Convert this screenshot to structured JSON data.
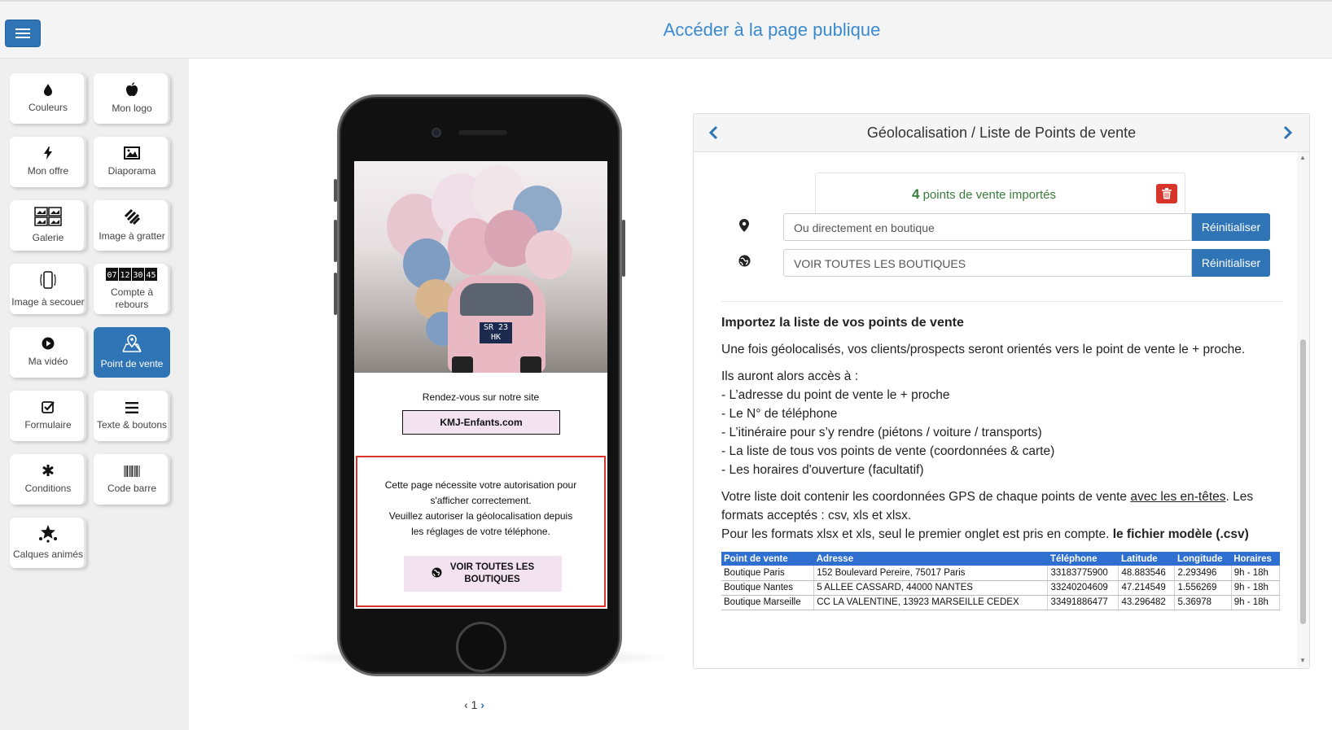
{
  "header": {
    "public_link": "Accéder à la page publique"
  },
  "sidebar": {
    "tools": [
      {
        "label": "Couleurs",
        "icon": "drop-icon",
        "glyph": "💧"
      },
      {
        "label": "Mon logo",
        "icon": "apple-icon",
        "glyph": ""
      },
      {
        "label": "Mon offre",
        "icon": "bolt-icon",
        "glyph": "⚡"
      },
      {
        "label": "Diaporama",
        "icon": "image-icon",
        "glyph": "🖼"
      },
      {
        "label": "Galerie",
        "icon": "gallery-icon",
        "glyph": "▦"
      },
      {
        "label": "Image à gratter",
        "icon": "scratch-icon",
        "glyph": "⫽"
      },
      {
        "label": "Image à secouer",
        "icon": "shake-phone-icon",
        "glyph": "📱"
      },
      {
        "label": "Compte à rebours",
        "icon": "countdown-icon",
        "glyph": "07 12 30 45"
      },
      {
        "label": "Ma vidéo",
        "icon": "play-icon",
        "glyph": "▶"
      },
      {
        "label": "Point de vente",
        "icon": "map-pin-icon",
        "glyph": "⌖"
      },
      {
        "label": "Formulaire",
        "icon": "checkbox-icon",
        "glyph": "☑"
      },
      {
        "label": "Texte & boutons",
        "icon": "list-icon",
        "glyph": "☰"
      },
      {
        "label": "Conditions",
        "icon": "asterisk-icon",
        "glyph": "✱"
      },
      {
        "label": "Code barre",
        "icon": "barcode-icon",
        "glyph": "||||"
      },
      {
        "label": "Calques animés",
        "icon": "stars-icon",
        "glyph": "★"
      }
    ],
    "active": "Point de vente"
  },
  "phone": {
    "plate": "SR 23 HK",
    "rdv_text": "Rendez-vous sur notre site",
    "site_button": "KMJ-Enfants.com",
    "alert_line1": "Cette page nécessite votre autorisation pour",
    "alert_line2": "s'afficher correctement.",
    "alert_line3": "Veuillez autoriser la géolocalisation depuis",
    "alert_line4": "les réglages de votre téléphone.",
    "stores_button_line1": "VOIR TOUTES LES",
    "stores_button_line2": "BOUTIQUES"
  },
  "pager": {
    "page": "1"
  },
  "panel": {
    "title": "Géolocalisation / Liste de Points de vente",
    "count": "4",
    "count_label": "points de vente importés",
    "field1_value": "Ou directement en boutique",
    "field2_value": "VOIR TOUTES LES BOUTIQUES",
    "reset_label": "Réinitialiser",
    "info_title": "Importez la liste de vos points de vente",
    "info_p1": "Une fois géolocalisés, vos clients/prospects seront orientés vers le point de vente le + proche.",
    "info_p2_intro": "Ils auront alors accès à :",
    "info_bullets": [
      "- L’adresse du point de vente le + proche",
      "- Le N° de téléphone",
      "- L’itinéraire pour s’y rendre (piétons / voiture / transports)",
      "- La liste de tous vos points de vente (coordonnées & carte)",
      "- Les horaires d'ouverture (facultatif)"
    ],
    "info_p3_a": "Votre liste doit contenir les coordonnées GPS de chaque points de vente ",
    "info_p3_link": "avec les en-têtes",
    "info_p3_b": ". Les formats acceptés : csv, xls et xlsx.",
    "info_p4": "Pour les formats xlsx et xls, seul le premier onglet est pris en compte. ",
    "info_p4_bold": "le fichier modèle (.csv)",
    "table": {
      "headers": [
        "Point de vente",
        "Adresse",
        "Téléphone",
        "Latitude",
        "Longitude",
        "Horaires"
      ],
      "rows": [
        [
          "Boutique Paris",
          "152 Boulevard Pereire, 75017 Paris",
          "33183775900",
          "48.883546",
          "2.293496",
          "9h - 18h"
        ],
        [
          "Boutique Nantes",
          "5 ALLEE CASSARD, 44000 NANTES",
          "33240204609",
          "47.214549",
          "1.556269",
          "9h - 18h"
        ],
        [
          "Boutique Marseille",
          "CC LA VALENTINE, 13923 MARSEILLE CEDEX",
          "33491886477",
          "43.296482",
          "5.36978",
          "9h - 18h"
        ]
      ]
    }
  },
  "colors": {
    "primary": "#2f74b5",
    "danger": "#d9342b",
    "success": "#3b7d3b",
    "link": "#3a8ad0"
  }
}
